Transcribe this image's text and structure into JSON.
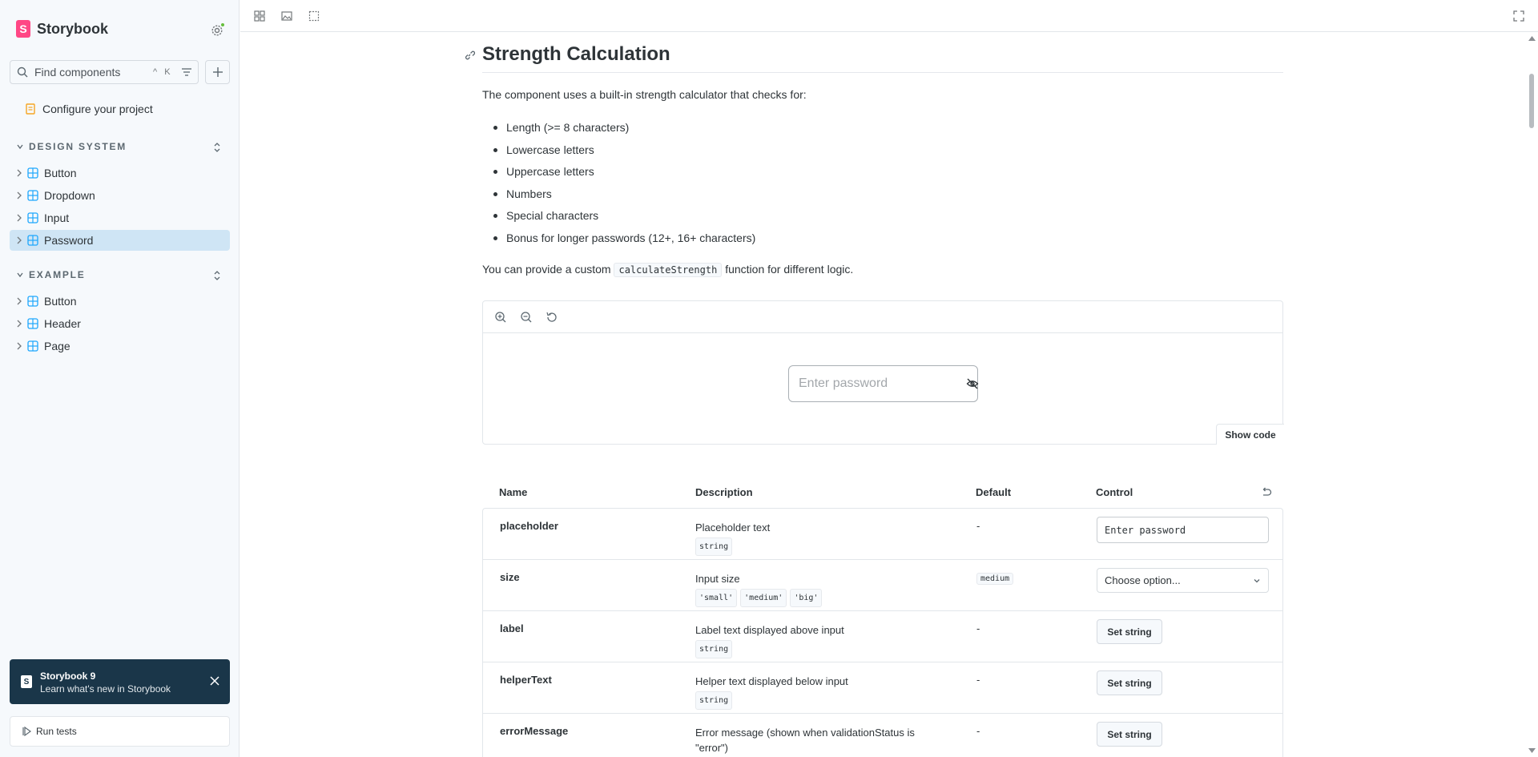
{
  "brand": {
    "name": "Storybook",
    "logo_letter": "S"
  },
  "search": {
    "placeholder": "Find components",
    "shortcut": "^ K"
  },
  "sidebar": {
    "doc_item": "Configure your project",
    "sections": [
      {
        "title": "DESIGN SYSTEM",
        "items": [
          "Button",
          "Dropdown",
          "Input",
          "Password"
        ],
        "active": "Password"
      },
      {
        "title": "EXAMPLE",
        "items": [
          "Button",
          "Header",
          "Page"
        ]
      }
    ]
  },
  "notification": {
    "title": "Storybook 9",
    "subtitle": "Learn what's new in Storybook"
  },
  "run_tests": "Run tests",
  "doc": {
    "heading": "Strength Calculation",
    "intro": "The component uses a built-in strength calculator that checks for:",
    "bullets": [
      "Length (>= 8 characters)",
      "Lowercase letters",
      "Uppercase letters",
      "Numbers",
      "Special characters",
      "Bonus for longer passwords (12+, 16+ characters)"
    ],
    "custom_prefix": "You can provide a custom",
    "custom_code": "calculateStrength",
    "custom_suffix": "function for different logic."
  },
  "preview": {
    "placeholder": "Enter password",
    "show_code": "Show code"
  },
  "args_table": {
    "headers": {
      "name": "Name",
      "description": "Description",
      "default": "Default",
      "control": "Control"
    },
    "rows": [
      {
        "name": "placeholder",
        "desc": "Placeholder text",
        "types": [
          "string"
        ],
        "default": "-",
        "control": "Enter password"
      },
      {
        "name": "size",
        "desc": "Input size",
        "types": [
          "'small'",
          "'medium'",
          "'big'"
        ],
        "default": "medium",
        "control": "Choose option..."
      },
      {
        "name": "label",
        "desc": "Label text displayed above input",
        "types": [
          "string"
        ],
        "default": "-",
        "control": "Set string"
      },
      {
        "name": "helperText",
        "desc": "Helper text displayed below input",
        "types": [
          "string"
        ],
        "default": "-",
        "control": "Set string"
      },
      {
        "name": "errorMessage",
        "desc": "Error message (shown when validationStatus is \"error\")",
        "types": [],
        "default": "-",
        "control": "Set string"
      }
    ]
  },
  "colors": {
    "accent": "#ff4785",
    "active_bg": "#cfe5f5",
    "component_icon": "#1ea7fd",
    "doc_icon": "#f5a623",
    "notif_bg": "#1a3649"
  }
}
